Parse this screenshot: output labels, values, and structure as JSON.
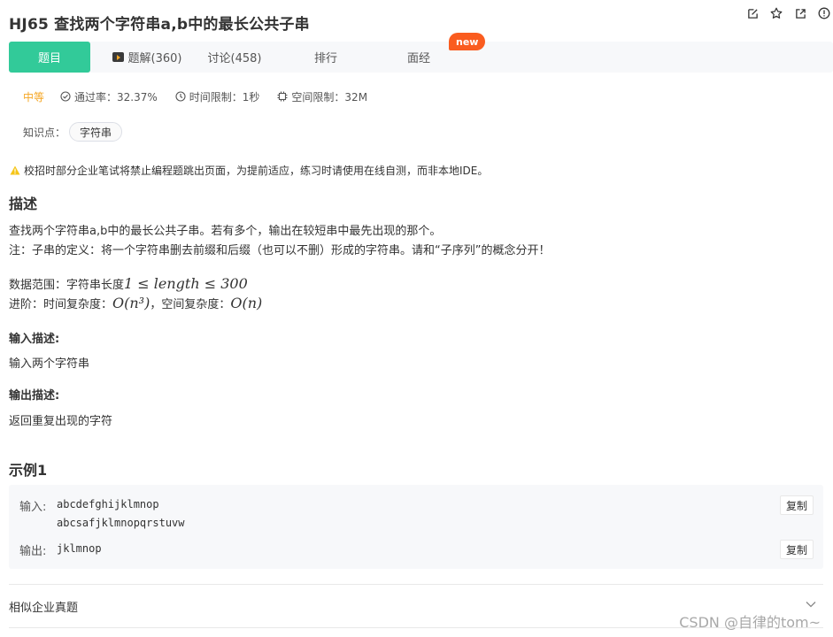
{
  "problem": {
    "title": "HJ65  查找两个字符串a,b中的最长公共子串"
  },
  "tabs": [
    {
      "label": "题目"
    },
    {
      "label": "题解(360)"
    },
    {
      "label": "讨论(458)"
    },
    {
      "label": "排行"
    },
    {
      "label": "面经"
    }
  ],
  "new_badge": "new",
  "meta": {
    "difficulty": "中等",
    "pass_rate": "通过率：32.37%",
    "time_limit": "时间限制：1秒",
    "space_limit": "空间限制：32M"
  },
  "knowledge": {
    "label": "知识点：",
    "tag": "字符串"
  },
  "warning": "校招时部分企业笔试将禁止编程题跳出页面，为提前适应，练习时请使用在线自测，而非本地IDE。",
  "description": {
    "heading": "描述",
    "line1": "查找两个字符串a,b中的最长公共子串。若有多个，输出在较短串中最先出现的那个。",
    "line2": "注：子串的定义：将一个字符串删去前缀和后缀（也可以不删）形成的字符串。请和“子序列”的概念分开！",
    "range_prefix": "数据范围：字符串长度",
    "range_math": "1 ≤ length ≤ 300",
    "advanced_prefix": "进阶：时间复杂度：",
    "time_complexity": "O(n³)",
    "advanced_mid": "，空间复杂度：",
    "space_complexity": "O(n)"
  },
  "input_desc": {
    "heading": "输入描述:",
    "text": "输入两个字符串"
  },
  "output_desc": {
    "heading": "输出描述:",
    "text": "返回重复出现的字符"
  },
  "example": {
    "heading": "示例1",
    "input_label": "输入:",
    "input_line1": "abcdefghijklmnop",
    "input_line2": "abcsafjklmnopqrstuvw",
    "output_label": "输出:",
    "output_value": "jklmnop",
    "copy_label": "复制"
  },
  "similar": {
    "label": "相似企业真题"
  },
  "watermark": "CSDN @自律的tom~",
  "colors": {
    "accent": "#32ca99",
    "badge": "#fa5c1f",
    "difficulty": "#f5a623",
    "warning": "#f5c518"
  },
  "icons": [
    "edit-icon",
    "star-icon",
    "share-icon",
    "report-icon",
    "video-icon",
    "check-circle-icon",
    "clock-icon",
    "chip-icon",
    "warning-icon",
    "chevron-down-icon"
  ]
}
